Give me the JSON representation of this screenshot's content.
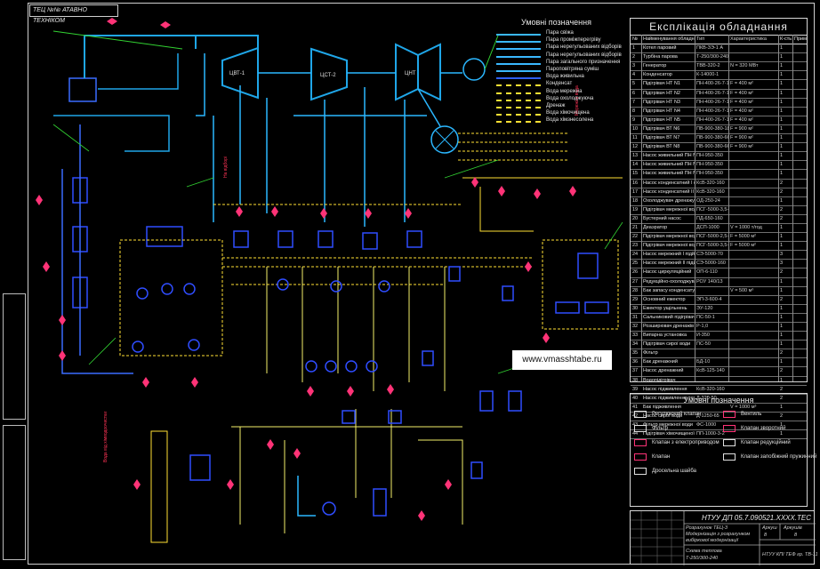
{
  "drawing": {
    "stamp_top_left": "ТЕЦ №№ АТАВНО ТЕХНІКОМ",
    "colors": {
      "steam_fresh": "#1fa6e8",
      "steam_extraction": "#2bb7ff",
      "feed_water": "#3a6cff",
      "condensate": "#ffe033",
      "cooling_water": "#f4ef6a",
      "drainage": "#d0d0d0",
      "valve": "#ff3377",
      "pump": "#2f4dff",
      "green": "#32d232"
    },
    "turbine_labels": {
      "hp": "ЦВТ-1",
      "ip": "ЦСТ-2",
      "lp": "ЦНТ"
    }
  },
  "legend_top": {
    "title": "Умовні позначення",
    "items": [
      {
        "label": "Пара свіжа",
        "color": "#3ab8ff",
        "style": "solid"
      },
      {
        "label": "Пара проміжперегріву",
        "color": "#3ab8ff",
        "style": "solid"
      },
      {
        "label": "Пара нерегульованих відборів",
        "color": "#3ab8ff",
        "style": "solid"
      },
      {
        "label": "Пара нерегульованих відборів",
        "color": "#3ab8ff",
        "style": "solid"
      },
      {
        "label": "Пара загального призначення",
        "color": "#3ab8ff",
        "style": "solid"
      },
      {
        "label": "Пароповітряна суміш",
        "color": "#3ab8ff",
        "style": "solid"
      },
      {
        "label": "Вода живильна",
        "color": "#2f60ff",
        "style": "solid"
      },
      {
        "label": "Конденсат",
        "color": "#ffe033",
        "style": "dashed"
      },
      {
        "label": "Вода мережна",
        "color": "#ffe033",
        "style": "dashed"
      },
      {
        "label": "Вода охолоджуюча",
        "color": "#ffe033",
        "style": "dashed"
      },
      {
        "label": "Дренаж",
        "color": "#ffe033",
        "style": "dashed"
      },
      {
        "label": "Вода хімочищена",
        "color": "#ffe033",
        "style": "dashed"
      },
      {
        "label": "Вода хімзнесолена",
        "color": "#ffe033",
        "style": "dashed"
      }
    ]
  },
  "equipment_table": {
    "title": "Експлікація обладнання",
    "headers": [
      "№",
      "Найменування обладнання",
      "Тип",
      "Характеристика",
      "К-сть",
      "Примітка"
    ],
    "rows": [
      [
        "1",
        "Котел паровий",
        "ПКВ-ЗЭ-1 А",
        "",
        "1",
        ""
      ],
      [
        "2",
        "Турбіна парова",
        "Т-250/300-240",
        "",
        "1",
        ""
      ],
      [
        "3",
        "Генератор",
        "ТВВ-320-2",
        "N = 320 МВт",
        "1",
        ""
      ],
      [
        "4",
        "Конденсатор",
        "К-14000-1",
        "",
        "1",
        ""
      ],
      [
        "5",
        "Підігрівач НТ N1",
        "ПН-400-26-7-1",
        "F = 400 м²",
        "1",
        ""
      ],
      [
        "6",
        "Підігрівач НТ N2",
        "ПН-400-26-7-1",
        "F = 400 м²",
        "1",
        ""
      ],
      [
        "7",
        "Підігрівач НТ N3",
        "ПН-400-26-7-1",
        "F = 400 м²",
        "1",
        ""
      ],
      [
        "8",
        "Підігрівач НТ N4",
        "ПН-400-26-7-1",
        "F = 400 м²",
        "1",
        ""
      ],
      [
        "9",
        "Підігрівач НТ N5",
        "ПН-400-26-7-1",
        "F = 400 м²",
        "1",
        ""
      ],
      [
        "10",
        "Підігрівач ВТ N6",
        "ПВ-900-380-18",
        "F = 900 м²",
        "1",
        ""
      ],
      [
        "11",
        "Підігрівач ВТ N7",
        "ПВ-900-380-66",
        "F = 900 м²",
        "1",
        ""
      ],
      [
        "12",
        "Підігрівач ВТ N8",
        "ПВ-900-380-66",
        "F = 900 м²",
        "1",
        ""
      ],
      [
        "13",
        "Насос живильний ПН N1",
        "ПН-950-350",
        "",
        "1",
        ""
      ],
      [
        "14",
        "Насос живильний ПН N2",
        "ПН-950-350",
        "",
        "1",
        ""
      ],
      [
        "15",
        "Насос живильний ПН N4",
        "ПН-950-350",
        "",
        "1",
        ""
      ],
      [
        "16",
        "Насос конденсатний I ступені",
        "КсВ-320-160",
        "",
        "2",
        ""
      ],
      [
        "17",
        "Насос конденсатний II ступені",
        "КсВ-320-160",
        "",
        "2",
        ""
      ],
      [
        "18",
        "Охолоджувач дренажу",
        "ОД-250-24",
        "",
        "1",
        ""
      ],
      [
        "19",
        "Підігрівач мережної води",
        "ПСГ-5000-3,5-8",
        "",
        "2",
        ""
      ],
      [
        "20",
        "Бустерний насос",
        "ПД-650-160",
        "",
        "2",
        ""
      ],
      [
        "21",
        "Деаэратор",
        "ДСП-1000",
        "V = 1000 т/год",
        "1",
        ""
      ],
      [
        "22",
        "Підігрівач мережної води I",
        "ПСГ-5000-2,5-8",
        "F = 5000 м²",
        "1",
        ""
      ],
      [
        "23",
        "Підігрівач мережної води II",
        "ПСГ-5000-3,5-8",
        "F = 5000 м²",
        "1",
        ""
      ],
      [
        "24",
        "Насос мережний I підйому",
        "СЭ-5000-70",
        "",
        "3",
        ""
      ],
      [
        "25",
        "Насос мережний II підйому",
        "СЭ-5000-160",
        "",
        "3",
        ""
      ],
      [
        "26",
        "Насос циркуляційний",
        "ОП-6-110",
        "",
        "2",
        ""
      ],
      [
        "27",
        "Редукційно-охолоджувальна установка",
        "РОУ 140/13",
        "",
        "1",
        ""
      ],
      [
        "28",
        "Бак запасу конденсату",
        "",
        "V = 500 м³",
        "1",
        ""
      ],
      [
        "29",
        "Основний ежектор",
        "ЭП-3-600-4",
        "",
        "2",
        ""
      ],
      [
        "30",
        "Ежектор ущільнень",
        "ЭУ-120",
        "",
        "1",
        ""
      ],
      [
        "31",
        "Сальниковий підігрівач",
        "ПС-50-1",
        "",
        "1",
        ""
      ],
      [
        "32",
        "Розширювач дренажів",
        "Р-1,0",
        "",
        "1",
        ""
      ],
      [
        "33",
        "Випарна установка",
        "И-350",
        "",
        "1",
        ""
      ],
      [
        "34",
        "Підігрівач сирої води",
        "ПС-50",
        "",
        "1",
        ""
      ],
      [
        "35",
        "Фільтр",
        "",
        "",
        "2",
        ""
      ],
      [
        "36",
        "Бак дренажний",
        "БД-10",
        "",
        "1",
        ""
      ],
      [
        "37",
        "Насос дренажний",
        "КсВ-125-140",
        "",
        "2",
        ""
      ],
      [
        "38",
        "Водопідігрівач",
        "",
        "",
        "1",
        ""
      ],
      [
        "39",
        "Насос підживлення",
        "КсВ-320-160",
        "",
        "2",
        ""
      ],
      [
        "40",
        "Насос підживлення тепломережі",
        "Д-320-50",
        "",
        "2",
        ""
      ],
      [
        "41",
        "Бак підживлення",
        "",
        "V = 1000 м³",
        "1",
        ""
      ],
      [
        "42",
        "Насос сирої води",
        "Д-1250-65",
        "",
        "2",
        ""
      ],
      [
        "43",
        "Фільтр мережної води",
        "ФС-1000",
        "",
        "1",
        ""
      ],
      [
        "44",
        "Підігрівач хімочищеної води",
        "ПП-1000-3-2",
        "",
        "1",
        ""
      ]
    ]
  },
  "symbol_legend": {
    "title": "Умовні позначення",
    "items": [
      {
        "label": "Регулюючий клапан",
        "color": "#e0e0e0"
      },
      {
        "label": "Вентиль",
        "color": "#ff3377"
      },
      {
        "label": "Фільтр",
        "color": "#e0e0e0"
      },
      {
        "label": "Клапан зворотний",
        "color": "#ff3377"
      },
      {
        "label": "Клапан з електроприводом",
        "color": "#ff3377"
      },
      {
        "label": "Клапан редукційний",
        "color": "#e0e0e0"
      },
      {
        "label": "Клапан",
        "color": "#ff3377"
      },
      {
        "label": "Клапан запобіжний пружинний",
        "color": "#e0e0e0"
      },
      {
        "label": "Дросельна шайба",
        "color": "#e0e0e0"
      }
    ]
  },
  "title_block": {
    "code": "НТУУ ДП 05.7.090521.XXXX.ТЕС",
    "line1": "Розрахунок ТЕЦ-3",
    "line2": "Модернізація з розрахунком",
    "line3": "вибіркової модернізації",
    "line4": "Схема теплова",
    "line5": "Т-250/300-240",
    "sheet_label": "Аркуш",
    "sheet_num": "8",
    "sheets_label": "Аркушів",
    "sheets_num": "8",
    "group": "НТУУ КПІ ТЕФ гр. ТВ-11"
  },
  "watermark": "www.vmasshtabe.ru"
}
